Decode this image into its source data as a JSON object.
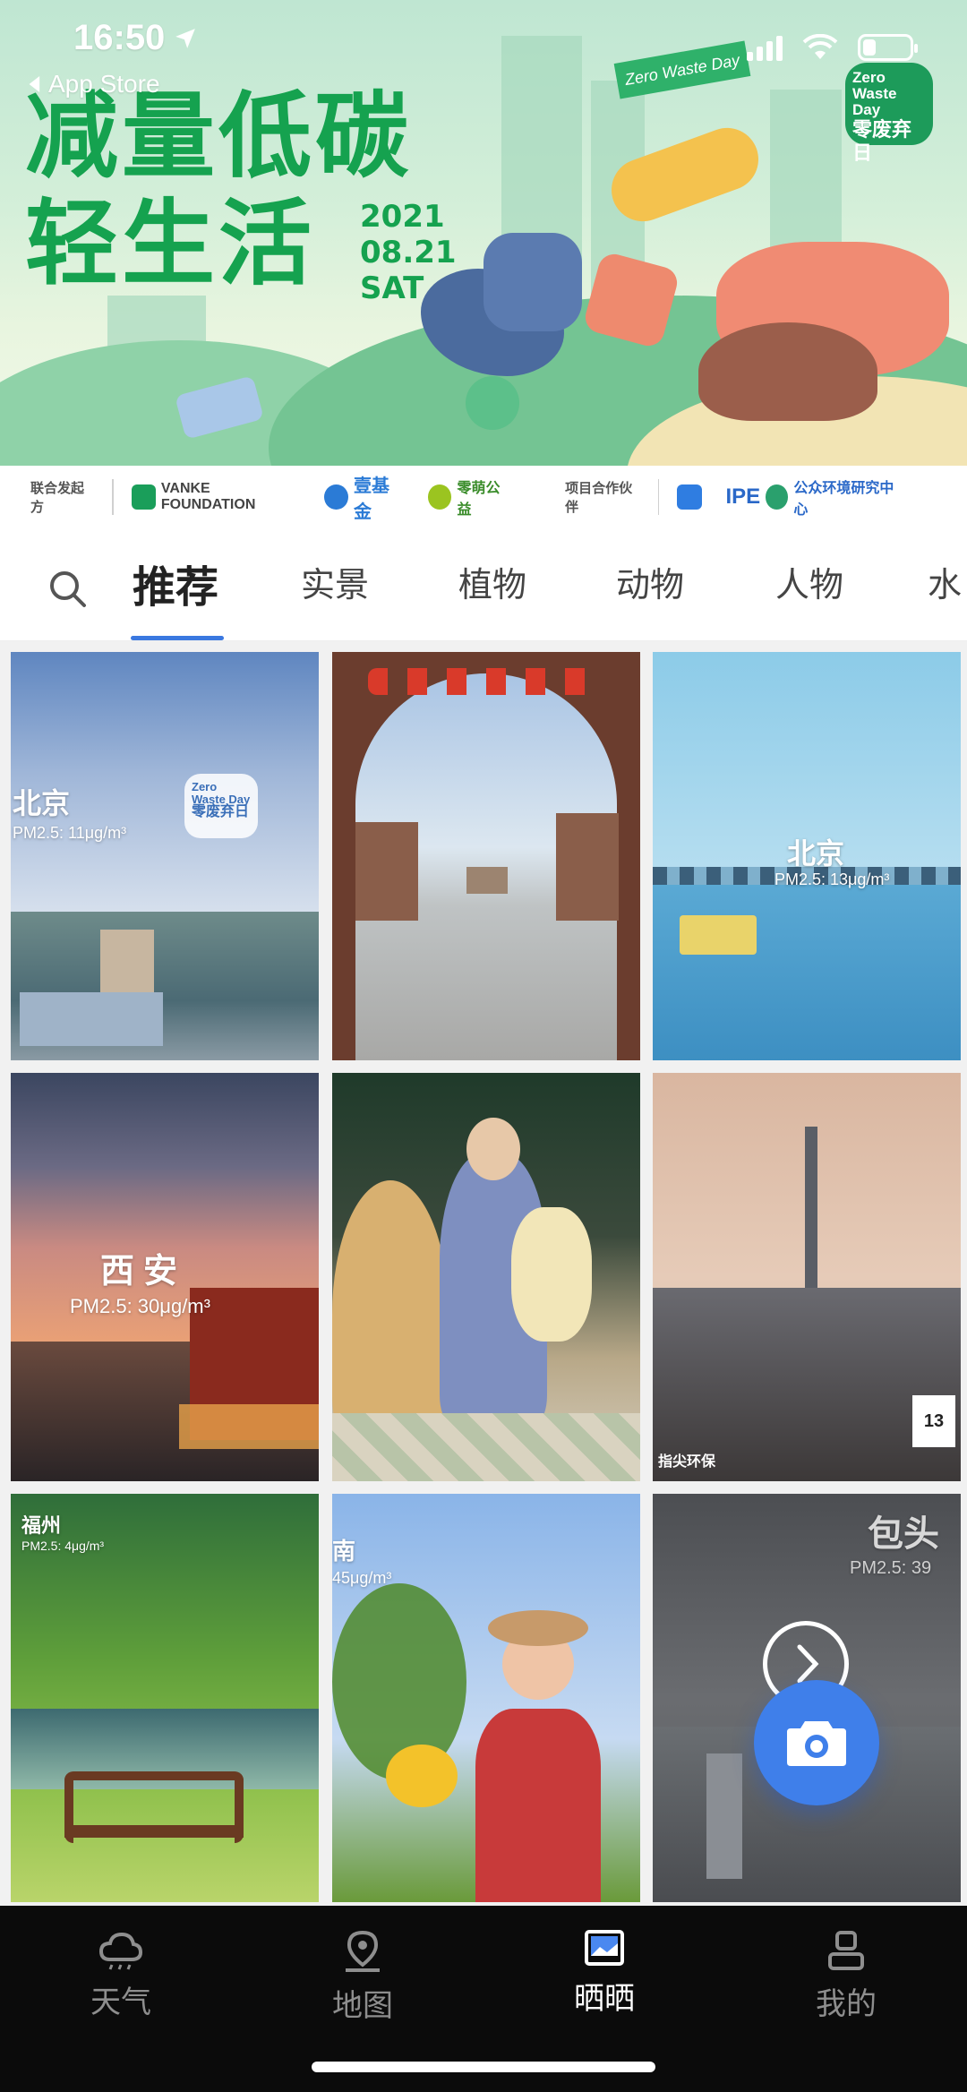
{
  "status_bar": {
    "time": "16:50",
    "back_label": "App Store"
  },
  "banner": {
    "title_line1": "减量低碳",
    "title_line2": "轻生活",
    "date_line1": "2021",
    "date_line2": "08.21",
    "date_line3": "SAT",
    "flag_text": "Zero Waste Day",
    "badge_text_en": "Zero Waste Day",
    "badge_text_cn": "零废弃日"
  },
  "sponsors": {
    "initiator_label": "联合发起方",
    "initiators": [
      "VANKE FOUNDATION",
      "壹基金",
      "零萌公益"
    ],
    "partner_label": "项目合作伙伴",
    "partners": [
      "IPE",
      "公众环境研究中心"
    ]
  },
  "tabs": [
    "推荐",
    "实景",
    "植物",
    "动物",
    "人物",
    "水"
  ],
  "active_tab": "推荐",
  "photos": [
    {
      "city": "北京",
      "pm": "PM2.5: 11μg/m³"
    },
    {
      "city": "",
      "pm": ""
    },
    {
      "city": "北京",
      "pm": "PM2.5: 13μg/m³"
    },
    {
      "city": "西安",
      "pm": "PM2.5: 30μg/m³"
    },
    {
      "city": "",
      "pm": ""
    },
    {
      "city": "",
      "pm": ""
    },
    {
      "city": "福州",
      "pm": "PM2.5: 4μg/m³"
    },
    {
      "city": "南",
      "pm": "45μg/m³"
    },
    {
      "city": "包头",
      "pm": "PM2.5: 39"
    }
  ],
  "tile_tags": {
    "brand": "指尖环保",
    "date_box": "13"
  },
  "bottom_nav": [
    {
      "label": "天气",
      "icon": "cloud-icon"
    },
    {
      "label": "地图",
      "icon": "map-pin-icon"
    },
    {
      "label": "晒晒",
      "icon": "photo-icon"
    },
    {
      "label": "我的",
      "icon": "profile-icon"
    }
  ],
  "active_nav": "晒晒",
  "colors": {
    "accent": "#3a78e0",
    "banner_green": "#15a24f",
    "fab": "#3f7fea",
    "nav_bg": "#0b0b0b"
  }
}
